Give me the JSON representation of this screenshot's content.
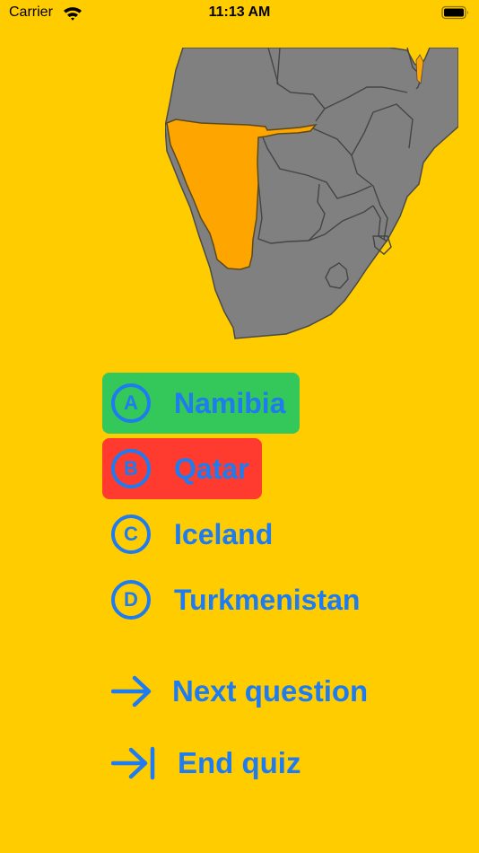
{
  "status": {
    "carrier": "Carrier",
    "time": "11:13 AM"
  },
  "colors": {
    "background": "#FFCC00",
    "accent": "#1E7BF0",
    "correct": "#34C759",
    "incorrect": "#FF3B30",
    "map_land": "#808080",
    "map_highlight": "#FFA500"
  },
  "map": {
    "highlighted_country": "Namibia"
  },
  "answers": [
    {
      "letter": "A",
      "label": "Namibia",
      "state": "correct"
    },
    {
      "letter": "B",
      "label": "Qatar",
      "state": "incorrect"
    },
    {
      "letter": "C",
      "label": "Iceland",
      "state": "none"
    },
    {
      "letter": "D",
      "label": "Turkmenistan",
      "state": "none"
    }
  ],
  "actions": {
    "next_label": "Next question",
    "next_icon": "arrow-right-icon",
    "end_label": "End quiz",
    "end_icon": "arrow-right-to-line-icon"
  }
}
